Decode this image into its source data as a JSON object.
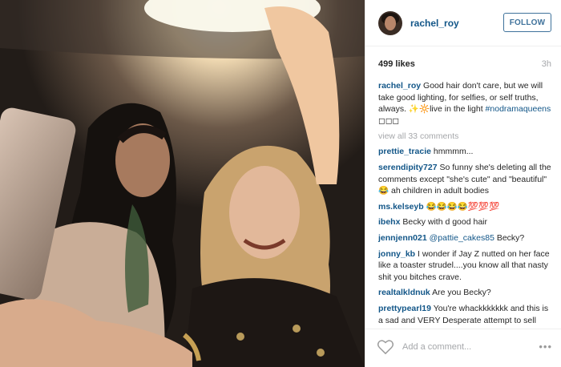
{
  "post": {
    "username": "rachel_roy",
    "follow_label": "FOLLOW",
    "likes": "499 likes",
    "time": "3h",
    "caption": {
      "user": "rachel_roy",
      "text": "Good hair don't care, but we will take good lighting, for selfies, or self truths, always. ✨🔆live in the light",
      "hashtag": "#nodramaqueens",
      "suffix": " ◻◻◻"
    },
    "view_all": "view all 33 comments",
    "comments": [
      {
        "user": "prettie_tracie",
        "text": "hmmmm..."
      },
      {
        "user": "serendipity727",
        "text": "So funny she's deleting all the comments except \"she's cute\" and \"beautiful\" 😂 ah children in adult bodies"
      },
      {
        "user": "ms.kelseyb",
        "text": "😂😂😂😂💯💯💯"
      },
      {
        "user": "ibehx",
        "text": "Becky with d good hair"
      },
      {
        "user": "jennjenn021",
        "mention": "@pattie_cakes85",
        "text": "Becky?"
      },
      {
        "user": "jonny_kb",
        "text": "I wonder if Jay Z nutted on her face like a toaster strudel....you know all that nasty shit you bitches crave."
      },
      {
        "user": "realtalkldnuk",
        "text": "Are you Becky?"
      },
      {
        "user": "prettypearl19",
        "text": "You're whackkkkkkk and this is a sad and VERY Desperate attempt to sell your Trash line that"
      }
    ],
    "add_comment_placeholder": "Add a comment...",
    "more_label": "•••"
  },
  "colors": {
    "username_blue": "#125688",
    "follow_blue": "#3f729b",
    "muted_gray": "#a5a7aa",
    "text_dark": "#262626"
  }
}
